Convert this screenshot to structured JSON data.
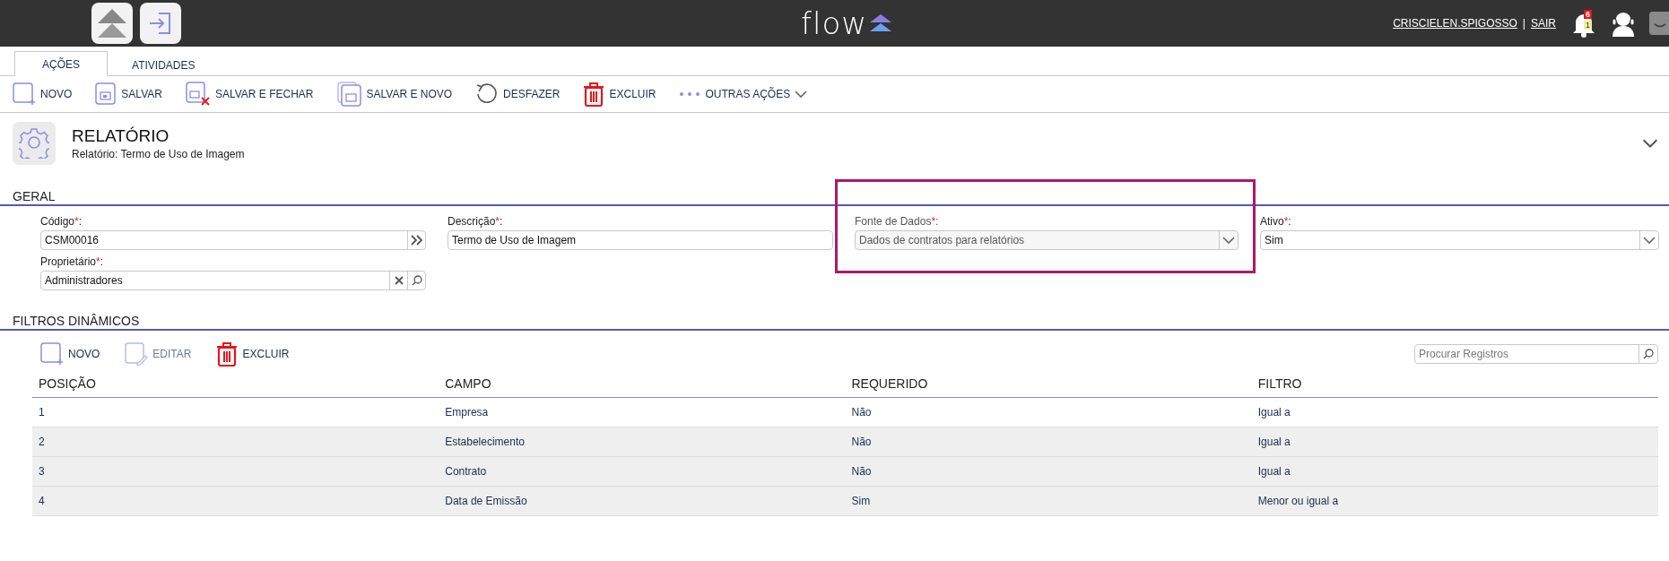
{
  "header": {
    "logo": "flow",
    "user": "CRISCIELEN.SPIGOSSO",
    "separator": "|",
    "logout": "SAIR",
    "notifications": "6",
    "pending": "1"
  },
  "tabs": [
    {
      "label": "AÇÕES",
      "selected": true
    },
    {
      "label": "ATIVIDADES",
      "selected": false
    }
  ],
  "toolbar": [
    {
      "kind": "new",
      "label": "NOVO"
    },
    {
      "kind": "save",
      "label": "SALVAR"
    },
    {
      "kind": "save-close",
      "label": "SALVAR E FECHAR"
    },
    {
      "kind": "save-new",
      "label": "SALVAR E NOVO"
    },
    {
      "kind": "undo",
      "label": "DESFAZER"
    },
    {
      "kind": "delete",
      "label": "EXCLUIR"
    },
    {
      "kind": "more",
      "label": "OUTRAS AÇÕES"
    }
  ],
  "page": {
    "title": "RELATÓRIO",
    "subtitle": "Relatório: Termo de Uso de Imagem"
  },
  "general": {
    "title": "GERAL",
    "fields": [
      {
        "kind": "lookup",
        "label": "Código",
        "required_mark": "*",
        "label_end": ":",
        "value": "CSM00016",
        "disabled": false,
        "highlighted": false
      },
      {
        "kind": "text",
        "label": "Descrição",
        "required_mark": "*",
        "label_end": ":",
        "value": "Termo de Uso de Imagem",
        "disabled": false,
        "highlighted": false
      },
      {
        "kind": "select",
        "label": "Fonte de Dados",
        "required_mark": "*",
        "label_end": ":",
        "value": "Dados de contratos para relatórios",
        "disabled": true,
        "highlighted": true
      },
      {
        "kind": "select",
        "label": "Ativo",
        "required_mark": "*",
        "label_end": ":",
        "value": "Sim",
        "disabled": false,
        "highlighted": false
      },
      {
        "kind": "search",
        "label": "Proprietário",
        "required_mark": "*",
        "label_end": ":",
        "value": "Administradores",
        "disabled": false,
        "highlighted": false
      }
    ]
  },
  "filters": {
    "title": "FILTROS DINÂMICOS",
    "toolbar": [
      {
        "kind": "new",
        "label": "NOVO",
        "disabled": false
      },
      {
        "kind": "edit",
        "label": "EDITAR",
        "disabled": true
      },
      {
        "kind": "delete",
        "label": "EXCLUIR",
        "disabled": false
      }
    ],
    "search": {
      "placeholder": "Procurar Registros"
    },
    "columns": [
      "POSIÇÃO",
      "CAMPO",
      "REQUERIDO",
      "FILTRO"
    ],
    "rows": [
      {
        "shaded": false,
        "cells": [
          "1",
          "Empresa",
          "Não",
          "Igual a"
        ]
      },
      {
        "shaded": true,
        "cells": [
          "2",
          "Estabelecimento",
          "Não",
          "Igual a"
        ]
      },
      {
        "shaded": true,
        "cells": [
          "3",
          "Contrato",
          "Não",
          "Igual a"
        ]
      },
      {
        "shaded": true,
        "cells": [
          "4",
          "Data de Emissão",
          "Sim",
          "Menor ou igual a"
        ]
      }
    ]
  }
}
